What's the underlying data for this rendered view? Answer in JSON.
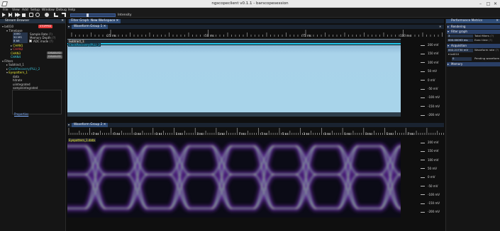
{
  "window": {
    "title": "ngscopeclient v0.1.1 - barscopesession"
  },
  "menu": [
    "File",
    "View",
    "Add",
    "Setup",
    "Window",
    "Debug",
    "Help"
  ],
  "toolbar": {
    "intensity_label": "Intensity",
    "intensity_value": 0.35
  },
  "stream_browser": {
    "title": "Stream Browser",
    "instrument": {
      "name": "bd010",
      "badge": "STOPPED"
    },
    "timebase": {
      "label": "Timebase",
      "sample_rate": "1000 MS/s",
      "sample_rate_label": "Sample Rate",
      "memory_depth": "50 MS",
      "memory_depth_label": "Memory Depth",
      "adc_bits": "8 bit",
      "adc_label": "ADC mode",
      "suffix": "(?)"
    },
    "channels": [
      {
        "name": "CHAN1",
        "color": "#e6e636"
      },
      {
        "name": "CHAN2",
        "color": "#e64646"
      },
      {
        "name": "CHAN3",
        "color": "#e6e636",
        "badge": "DISABLED"
      },
      {
        "name": "CHAN4",
        "color": "#3fd9e6",
        "badge": "DISABLED"
      }
    ],
    "filters_label": "Filters",
    "filters": [
      {
        "name": "Subtract_1",
        "color": "#cfcfcf"
      },
      {
        "name": "ClockRecovery(PLL)_2",
        "color": "#3bbfd6"
      },
      {
        "name": "Eyepattern_1",
        "color": "#e6e636"
      }
    ],
    "eye_streams": [
      "data",
      "hitrate",
      "uiintegrated",
      "sampleintegrated"
    ],
    "properties_button": "Properties"
  },
  "center": {
    "tabs": [
      "Filter Graph",
      "New Workspace"
    ],
    "group1": {
      "tab": "Waveform Group 1",
      "time_labels": [
        "25 ms",
        "50 ms",
        "75 ms",
        "100 ms"
      ],
      "trace_labels": [
        "Subtract_1",
        "ClockRecovery(PLL)_2"
      ],
      "volt_labels": [
        "200 mV",
        "150 mV",
        "100 mV",
        "50 mV",
        "0 mV",
        "-50 mV",
        "-100 mV",
        "-150 mV",
        "-200 mV"
      ]
    },
    "group2": {
      "tab": "Waveform Group 2",
      "time_labels": [
        "-7 ns",
        "-5 ns",
        "-3 ns",
        "-1 ns",
        "1 ns",
        "3 ns",
        "5 ns",
        "7 ns",
        "-7 ns",
        "-5 ns",
        "-3 ns",
        "-1 ns",
        "1 ns",
        "3 ns",
        "5 ns",
        "7 ns"
      ],
      "trace_label": "Eyepattern_1.data",
      "volt_labels": [
        "200 mV",
        "150 mV",
        "100 mV",
        "50 mV",
        "0 mV",
        "-50 mV",
        "-100 mV",
        "-150 mV",
        "-200 mV"
      ]
    }
  },
  "perf": {
    "title": "Performance Metrics",
    "sections": {
      "rendering": "Rendering",
      "filter_graph": "Filter graph",
      "acquisition": "Acquisition",
      "memory": "Memory"
    },
    "total_filters_value": "3",
    "total_filters_label": "Total filters",
    "exec_time_value": "000.00093 ms",
    "exec_time_label": "Exec time",
    "waveform_rate_value": "002.21730 mV",
    "waveform_rate_label": "Waveform rate",
    "instrument": "bd010",
    "pending_value": "0",
    "pending_label": "Pending waveform",
    "help": "(?)"
  }
}
